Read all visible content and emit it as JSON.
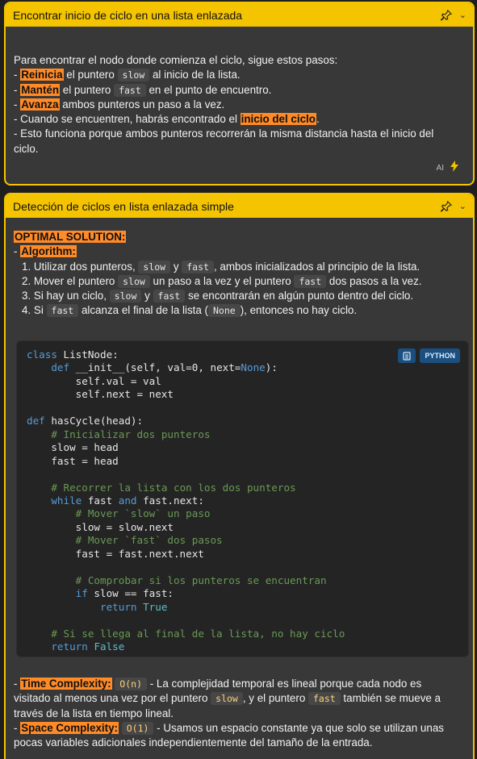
{
  "card1": {
    "title": "Encontrar inicio de ciclo en una lista enlazada",
    "intro": "Para encontrar el nodo donde comienza el ciclo, sigue estos pasos:",
    "step1_dash": "- ",
    "step1_hl": "Reinicia",
    "step1_a": " el puntero ",
    "step1_code": "slow",
    "step1_b": " al inicio de la lista.",
    "step2_dash": "- ",
    "step2_hl": "Mantén",
    "step2_a": " el puntero ",
    "step2_code": "fast",
    "step2_b": " en el punto de encuentro.",
    "step3_dash": "- ",
    "step3_hl": "Avanza",
    "step3_b": " ambos punteros un paso a la vez.",
    "step4_a": "- Cuando se encuentren, habrás encontrado el ",
    "step4_hl": "inicio del ciclo",
    "step4_b": ".",
    "step5_line1": "- Esto funciona porque ambos punteros recorrerán la misma distancia hasta el inicio del",
    "step5_line2": "ciclo.",
    "ai_label": "AI"
  },
  "card2": {
    "title": "Detección de ciclos en lista enlazada simple",
    "optimal": "OPTIMAL SOLUTION:",
    "alg_dash": "- ",
    "alg_hl": "Algorithm:",
    "item1_a": "1. Utilizar dos punteros, ",
    "item1_c1": "slow",
    "item1_b": " y ",
    "item1_c2": "fast",
    "item1_c": ", ambos inicializados al principio de la lista.",
    "item2_a": "2. Mover el puntero ",
    "item2_c1": "slow",
    "item2_b": " un paso a la vez y el puntero ",
    "item2_c2": "fast",
    "item2_c": " dos pasos a la vez.",
    "item3_a": "3. Si hay un ciclo, ",
    "item3_c1": "slow",
    "item3_b": " y ",
    "item3_c2": "fast",
    "item3_c": " se encontrarán en algún punto dentro del ciclo.",
    "item4_a": "4. Si ",
    "item4_c1": "fast",
    "item4_b": " alcanza el final de la lista (",
    "item4_c2": "None",
    "item4_c": "), entonces no hay ciclo.",
    "code_lang": "PYTHON",
    "time_dash": "- ",
    "time_hl": "Time Complexity:",
    "time_code": "O(n)",
    "time_a": " - La complejidad temporal es lineal porque cada nodo es",
    "time_b": "visitado al menos una vez por el puntero ",
    "time_code2": "slow",
    "time_c": ", y el puntero ",
    "time_code3": "fast",
    "time_d": " también se mueve a",
    "time_e": "través de la lista en tiempo lineal.",
    "space_dash": "- ",
    "space_hl": "Space Complexity:",
    "space_code": "O(1)",
    "space_a": " - Usamos un espacio constante ya que solo se utilizan unas",
    "space_b": "pocas variables adicionales independientemente del tamaño de la entrada."
  },
  "icons": {
    "pin": "pin-icon",
    "chevron": "chevron-down-icon",
    "bolt": "lightning-icon",
    "copy": "copy-icon"
  },
  "colors": {
    "header": "#f5c400",
    "highlight": "#ff8a28",
    "card_bg": "#383838",
    "code_bg": "#242424"
  }
}
